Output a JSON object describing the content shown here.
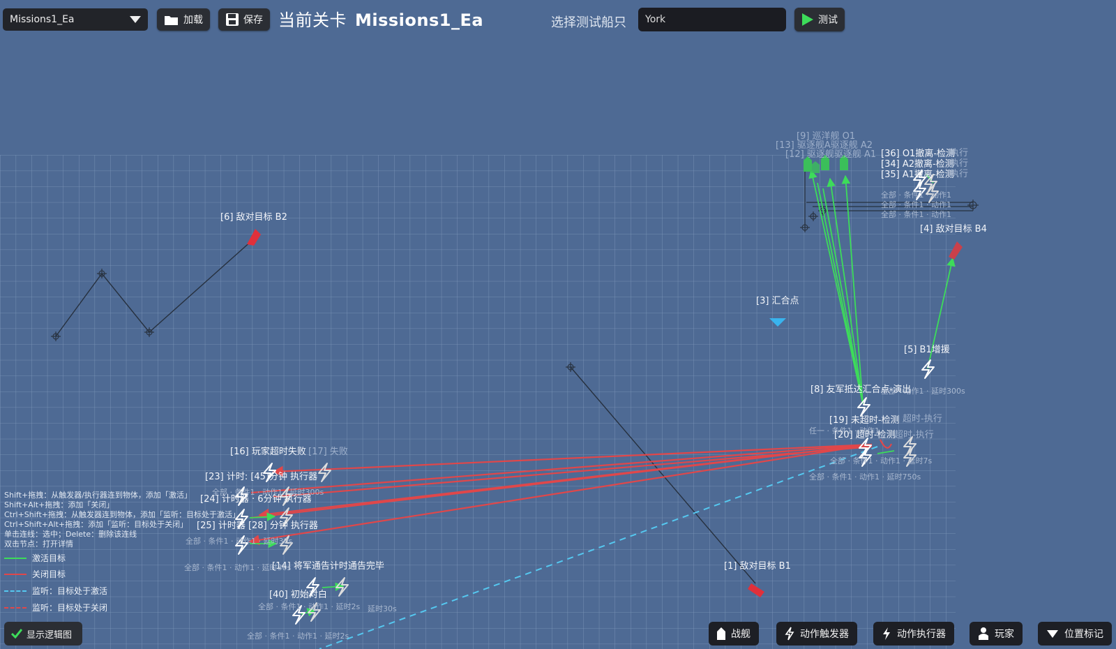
{
  "toolbar": {
    "mission_select": "Missions1_Ea",
    "load_label": "加载",
    "save_label": "保存",
    "current_level_label": "当前关卡",
    "current_level_value": "Missions1_Ea",
    "choose_ship_label": "选择测试船只",
    "ship_value": "York",
    "test_label": "测试"
  },
  "nodes": {
    "enemy_b2": "[6] 敌对目标 B2",
    "enemy_b4": "[4] 敌对目标 B4",
    "enemy_b1": "[1] 敌对目标 B1",
    "rally": "[3] 汇合点",
    "cruiser_o1": "[9] 巡洋舰 O1",
    "destroyer_a2": "[13] 驱逐舰A驱逐舰 A2",
    "destroyer_a1": "[12] 驱逐舰驱逐舰 A1",
    "trig36": "[36] O1撤离-检测",
    "trig34": "[34] A2撤离-检测",
    "trig35": "[35] A1撤离-检测",
    "exec_suffix_36": "执行",
    "exec_suffix_34": "执行",
    "exec_suffix_35": "执行",
    "cond_36": "全部 · 条件1 · 动作1",
    "cond_34": "全部 · 条件1 · 动作1",
    "cond_35": "全部 · 条件1 · 动作1",
    "b1_reinforce": "[5] B1增援",
    "b1_reinforce_sub": "全部 · 动作1 · 延时300s",
    "ally_rally": "[8] 友军抵达汇合点-演出",
    "not_timeout": "[19] 未超时-检测",
    "not_timeout_exec": "超时-执行",
    "not_timeout_sub": "任一 · 条件1 · 动作1",
    "timeout": "[20] 超时-检测",
    "timeout_exec": "超时-执行",
    "timeout_sub1": "全部 · 条件1 · 动作1 · 延时7s",
    "timeout_sub2": "全部 · 条件1 · 动作1 · 延时750s",
    "player_fail": "[16] 玩家超时失败",
    "fail17": "[17] 失败",
    "timer23": "[23] 计时: [45]分钟 执行器",
    "timer23_sub": "全部 · 条件1 · 动作1 · 延时300s",
    "timer24": "[24] 计时器 · 6分钟 执行器",
    "timer25": "[25] 计时器 [28] 分钟 执行器",
    "timer25_sub": "全部 · 条件1 · 动作1 · 延时30s",
    "fleet_notice": "[14] 将军通告计时通告完毕",
    "fleet_notice_sub": "全部 · 条件1 · 动作1 · 延时30s",
    "initial": "[40] 初始对白",
    "initial_sub": "全部 · 条件1 · 动作1 · 延时2s",
    "initial_sub2": "全部 · 条件1 · 动作1 · 延时2s",
    "delay30": "延时30s"
  },
  "help": {
    "line1": "Shift+拖拽：从触发器/执行器连到物体，添加「激活」",
    "line2": "Shift+Alt+拖拽：添加「关闭」",
    "line3": "Ctrl+Shift+拖拽：从触发器连到物体，添加「监听：目标处于激活」",
    "line4": "Ctrl+Shift+Alt+拖拽：添加「监听：目标处于关闭」",
    "line5": "单击连线：选中；Delete：删除该连线",
    "line6": "双击节点：打开详情"
  },
  "legend": [
    {
      "label": "激活目标",
      "color": "#3ddc5a",
      "style": "solid"
    },
    {
      "label": "关闭目标",
      "color": "#e0474a",
      "style": "solid"
    },
    {
      "label": "监听：目标处于激活",
      "color": "#55c8f0",
      "style": "dashed"
    },
    {
      "label": "监听：目标处于关闭",
      "color": "#e0474a",
      "style": "dashed"
    }
  ],
  "bottom": {
    "show_logic": "显示逻辑图",
    "warship": "战舰",
    "trigger": "动作触发器",
    "executor": "动作执行器",
    "player": "玩家",
    "marker": "位置标记"
  },
  "colors": {
    "background": "#4e6a94",
    "activate": "#3ddc5a",
    "deactivate": "#e0474a",
    "listen_active": "#55c8f0",
    "enemy": "#e0303a",
    "ally": "#3bbf5a"
  }
}
